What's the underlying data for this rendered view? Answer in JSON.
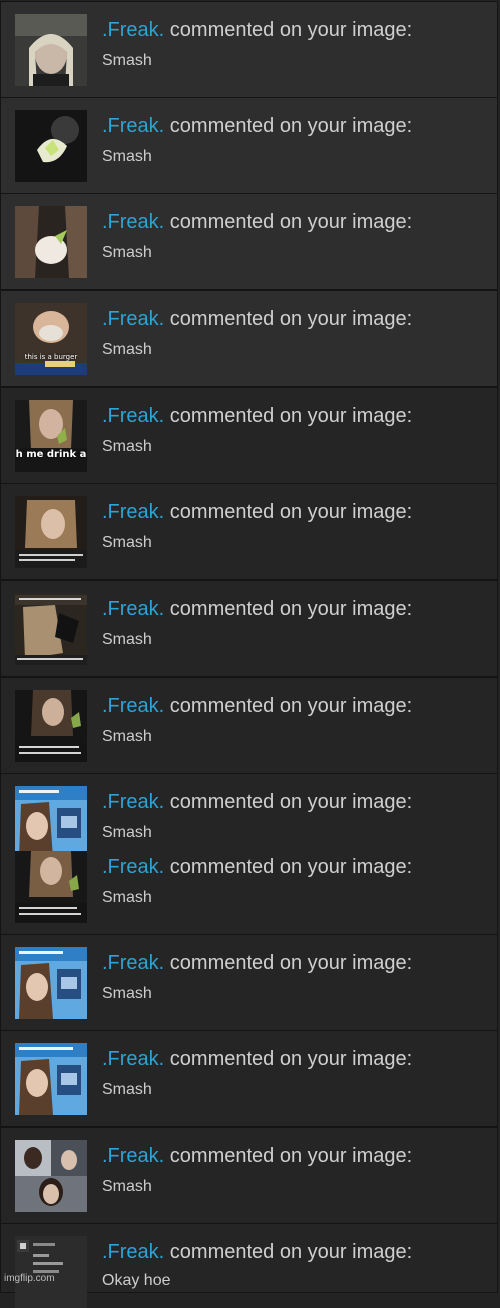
{
  "notifications": [
    {
      "user": ".Freak.",
      "action": " commented on your image:",
      "comment": "Smash",
      "caption": ""
    },
    {
      "user": ".Freak.",
      "action": " commented on your image:",
      "comment": "Smash",
      "caption": ""
    },
    {
      "user": ".Freak.",
      "action": " commented on your image:",
      "comment": "Smash",
      "caption": ""
    },
    {
      "user": ".Freak.",
      "action": " commented on your image:",
      "comment": "Smash",
      "caption": "this is a burger"
    },
    {
      "user": ".Freak.",
      "action": " commented on your image:",
      "comment": "Smash",
      "caption": "h me drink a"
    },
    {
      "user": ".Freak.",
      "action": " commented on your image:",
      "comment": "Smash",
      "caption": ""
    },
    {
      "user": ".Freak.",
      "action": " commented on your image:",
      "comment": "Smash",
      "caption": ""
    },
    {
      "user": ".Freak.",
      "action": " commented on your image:",
      "comment": "Smash",
      "caption": ""
    },
    {
      "user": ".Freak.",
      "action": " commented on your image:",
      "comment": "Smash",
      "caption": ""
    },
    {
      "user": ".Freak.",
      "action": " commented on your image:",
      "comment": "Smash",
      "caption": ""
    },
    {
      "user": ".Freak.",
      "action": " commented on your image:",
      "comment": "Smash",
      "caption": ""
    },
    {
      "user": ".Freak.",
      "action": " commented on your image:",
      "comment": "Smash",
      "caption": ""
    },
    {
      "user": ".Freak.",
      "action": " commented on your image:",
      "comment": "Smash",
      "caption": ""
    },
    {
      "user": ".Freak.",
      "action": " commented on your image:",
      "comment": "Okay hoe",
      "caption": ""
    }
  ],
  "watermark": "imgflip.com",
  "colors": {
    "username": "#2ba4d6",
    "text": "#cfcfcf",
    "row_light": "#2e2e2e",
    "row_dark": "#252525"
  }
}
